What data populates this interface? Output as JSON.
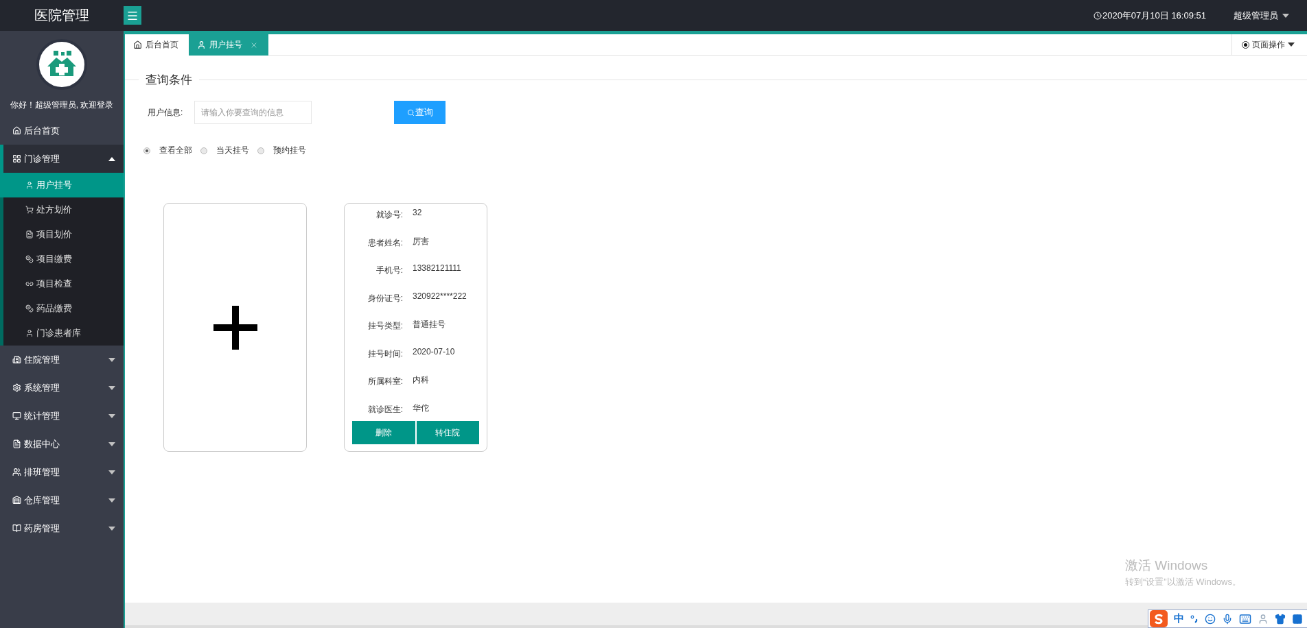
{
  "header": {
    "title": "医院管理",
    "datetime": "2020年07月10日 16:09:51",
    "user": "超级管理员"
  },
  "sidebar": {
    "greeting": "你好！超级管理员, 欢迎登录",
    "items": [
      {
        "kind": "link",
        "label": "后台首页"
      },
      {
        "kind": "group",
        "label": "门诊管理",
        "expanded": true,
        "children": [
          {
            "label": "用户挂号",
            "selected": true
          },
          {
            "label": "处方划价",
            "selected": false
          },
          {
            "label": "项目划价",
            "selected": false
          },
          {
            "label": "项目缴费",
            "selected": false
          },
          {
            "label": "项目检查",
            "selected": false
          },
          {
            "label": "药品缴费",
            "selected": false
          },
          {
            "label": "门诊患者库",
            "selected": false
          }
        ]
      },
      {
        "kind": "group",
        "label": "住院管理",
        "expanded": false
      },
      {
        "kind": "group",
        "label": "系统管理",
        "expanded": false
      },
      {
        "kind": "group",
        "label": "统计管理",
        "expanded": false
      },
      {
        "kind": "group",
        "label": "数据中心",
        "expanded": false
      },
      {
        "kind": "group",
        "label": "排班管理",
        "expanded": false
      },
      {
        "kind": "group",
        "label": "仓库管理",
        "expanded": false
      },
      {
        "kind": "group",
        "label": "药房管理",
        "expanded": false
      }
    ]
  },
  "tabs": [
    {
      "label": "后台首页",
      "selected": false,
      "closable": false
    },
    {
      "label": "用户挂号",
      "selected": true,
      "closable": true
    }
  ],
  "page_actions": "页面操作",
  "search": {
    "legend": "查询条件",
    "label": "用户信息:",
    "placeholder": "请输入你要查询的信息",
    "button": "查询"
  },
  "filters": [
    {
      "label": "查看全部",
      "selected": true
    },
    {
      "label": "当天挂号",
      "selected": false
    },
    {
      "label": "预约挂号",
      "selected": false
    }
  ],
  "cards": [
    {
      "kind": "add"
    },
    {
      "kind": "patient",
      "fields": [
        {
          "label": "就诊号:",
          "value": "32"
        },
        {
          "label": "患者姓名:",
          "value": "厉害"
        },
        {
          "label": "手机号:",
          "value": "13382121111"
        },
        {
          "label": "身份证号:",
          "value": "320922****222"
        },
        {
          "label": "挂号类型:",
          "value": "普通挂号"
        },
        {
          "label": "挂号时间:",
          "value": "2020-07-10"
        },
        {
          "label": "所属科室:",
          "value": "内科"
        },
        {
          "label": "就诊医生:",
          "value": "华佗"
        }
      ],
      "actions": [
        "删除",
        "转住院"
      ]
    }
  ],
  "windows_activation": {
    "title": "激活 Windows",
    "hint": "转到“设置”以激活 Windows。"
  },
  "ime_bar": {
    "mode": "中"
  }
}
